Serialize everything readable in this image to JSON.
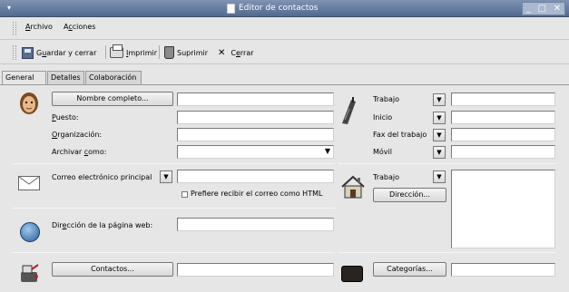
{
  "window": {
    "title": "Editor de contactos",
    "menu_glyph": "▾",
    "controls": {
      "minimize": "_",
      "maximize": "□",
      "close": "✕"
    }
  },
  "menubar": {
    "archivo": {
      "mnemonic": "A",
      "rest": "rchivo"
    },
    "acciones": {
      "pre": "A",
      "mnemonic": "c",
      "rest": "ciones"
    }
  },
  "toolbar": {
    "save": {
      "pre": "G",
      "mnemonic": "u",
      "rest": "ardar y cerrar"
    },
    "print": {
      "mnemonic": "I",
      "rest": "mprimir"
    },
    "delete": "Suprimir",
    "close_glyph": "✕",
    "close": {
      "pre": "C",
      "mnemonic": "e",
      "rest": "rrar"
    }
  },
  "tabs": [
    {
      "label": "General",
      "active": true
    },
    {
      "label": "Detalles",
      "active": false
    },
    {
      "label": "Colaboración",
      "active": false
    }
  ],
  "identity": {
    "fullname_button": "Nombre completo...",
    "fullname_value": "",
    "puesto": {
      "mnemonic": "P",
      "rest": "uesto:"
    },
    "organizacion": {
      "mnemonic": "O",
      "rest": "rganización:"
    },
    "archivar": {
      "pre": "Archivar ",
      "mnemonic": "c",
      "rest": "omo:"
    },
    "puesto_value": "",
    "organizacion_value": "",
    "archivar_value": ""
  },
  "phones": [
    {
      "label": "Trabajo",
      "value": ""
    },
    {
      "label": "Inicio",
      "value": ""
    },
    {
      "label": "Fax del trabajo",
      "value": ""
    },
    {
      "label": "Móvil",
      "value": ""
    }
  ],
  "email": {
    "label": "Correo electrónico principal",
    "value": "",
    "html_pref": "Prefiere recibir el correo como HTML",
    "html_pref_checked": false
  },
  "address": {
    "type": "Trabajo",
    "button": "Dirección...",
    "value": ""
  },
  "web": {
    "pre": "Dir",
    "mnemonic": "e",
    "rest": "cción de la página web:",
    "value": ""
  },
  "contacts": {
    "button": "Contactos...",
    "value": ""
  },
  "categories": {
    "button": "Categorías...",
    "value": ""
  },
  "dropdown_glyph": "▼",
  "icon_names": [
    "person-icon",
    "phone-icon",
    "mail-icon",
    "globe-icon",
    "house-icon",
    "contacts-icon",
    "briefcase-icon"
  ]
}
